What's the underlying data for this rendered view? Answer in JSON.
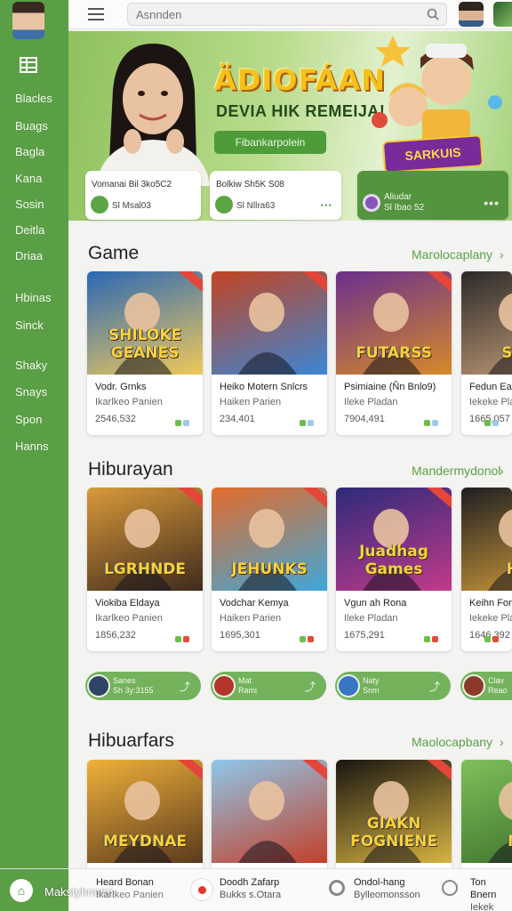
{
  "sidebar": {
    "items": [
      "Blacles",
      "Buags",
      "Bagla",
      "Kana",
      "Sosin",
      "Deitla",
      "Driaa",
      "Hbinas",
      "Sinck",
      "Shaky",
      "Snays",
      "Spon",
      "Hanns"
    ]
  },
  "topbar": {
    "search_placeholder": "Asnnden"
  },
  "banner": {
    "title": "ÄDIOFÁAN",
    "subtitle": "DEVIA HIK REMEIJA!",
    "button": "Fibankarpolein",
    "logo": "SARKUIS",
    "cards": [
      {
        "line1": "Vomanai Bil 3ko5C2",
        "line2": "Sl Msal03",
        "dots": "•••"
      },
      {
        "line1": "Bolkiw Sh5K S08",
        "line2": "Sl Nllra63",
        "dots": "•••"
      },
      {
        "line1": "Aliudar",
        "line2": "Sl Ibao 52",
        "dots": "•••"
      }
    ]
  },
  "sections": [
    {
      "title": "Game",
      "link": "Marolocaplany",
      "cards": [
        {
          "art_title": "SHILOKE GEANES",
          "name": "Vodr. Grnks",
          "sub": "Ikarlkeo Panien",
          "num": "2546,532",
          "colors": [
            "#2a68b5",
            "#f0c95a"
          ]
        },
        {
          "art_title": "",
          "name": "Heiko Motern Snlcrs",
          "sub": "Haiken Parien",
          "num": "234,401",
          "colors": [
            "#c24422",
            "#3b86d4"
          ]
        },
        {
          "art_title": "FUTARSS",
          "name": "Psimiaine (Ñn Bnlo9)",
          "sub": "Ileke Pladan",
          "num": "7904,491",
          "colors": [
            "#6a2f8c",
            "#d68a2a"
          ]
        },
        {
          "art_title": "SAN",
          "name": "Fedun Eas",
          "sub": "Iekeke Plan",
          "num": "1665,057",
          "colors": [
            "#2c2a2a",
            "#c9a17a"
          ]
        }
      ]
    },
    {
      "title": "Hiburayan",
      "link": "Mandermydonol",
      "cards": [
        {
          "art_title": "LGRHNDE",
          "name": "Viokiba Eldaya",
          "sub": "Ikarlkeo Panien",
          "num": "1856,232",
          "colors": [
            "#d99a3a",
            "#3f2a1c"
          ]
        },
        {
          "art_title": "JEHUNKS",
          "name": "Vodchar Kemya",
          "sub": "Haiken Parien",
          "num": "1695,301",
          "colors": [
            "#e46b2a",
            "#3fa7d8"
          ]
        },
        {
          "art_title": "Juadhag Games",
          "name": "Vgun ah Rona",
          "sub": "Ileke Pladan",
          "num": "1675,291",
          "colors": [
            "#2d2a7a",
            "#c23a8a"
          ]
        },
        {
          "art_title": "HO",
          "name": "Keihn Fon",
          "sub": "Iekeke Plan",
          "num": "1646,392",
          "colors": [
            "#1e1e22",
            "#d8a13a"
          ]
        }
      ],
      "pills": [
        {
          "line1": "Sanes",
          "line2": "Sh 3y:3155"
        },
        {
          "line1": "Mat",
          "line2": "Rami"
        },
        {
          "line1": "Naty",
          "line2": "Snm"
        },
        {
          "line1": "Clav",
          "line2": "Reao"
        }
      ]
    },
    {
      "title": "Hibuarfars",
      "link": "Maolocapbany",
      "cards": [
        {
          "art_title": "MEYDNAE",
          "name": "",
          "sub": "",
          "num": "",
          "colors": [
            "#f0b13a",
            "#5a3a1c"
          ]
        },
        {
          "art_title": "",
          "name": "",
          "sub": "",
          "num": "",
          "colors": [
            "#8fc7ea",
            "#c2402a"
          ]
        },
        {
          "art_title": "GIAKN FOGNIENE",
          "name": "",
          "sub": "",
          "num": "",
          "colors": [
            "#1a1612",
            "#d6b341"
          ]
        },
        {
          "art_title": "NE",
          "name": "",
          "sub": "",
          "num": "",
          "colors": [
            "#7ec05a",
            "#3a6e2a"
          ]
        }
      ]
    }
  ],
  "bottombar": {
    "home_label": "Makstyhnenn",
    "items": [
      {
        "line1": "Heard Bonan",
        "line2": "Ikarlkeo Panien"
      },
      {
        "line1": "Doodh Zafarp",
        "line2": "Bukks s.Otara"
      },
      {
        "line1": "Ondol-hang",
        "line2": "Bylleomonsson"
      },
      {
        "line1": "Ton Bnern",
        "line2": "Iekek Pan"
      }
    ]
  }
}
